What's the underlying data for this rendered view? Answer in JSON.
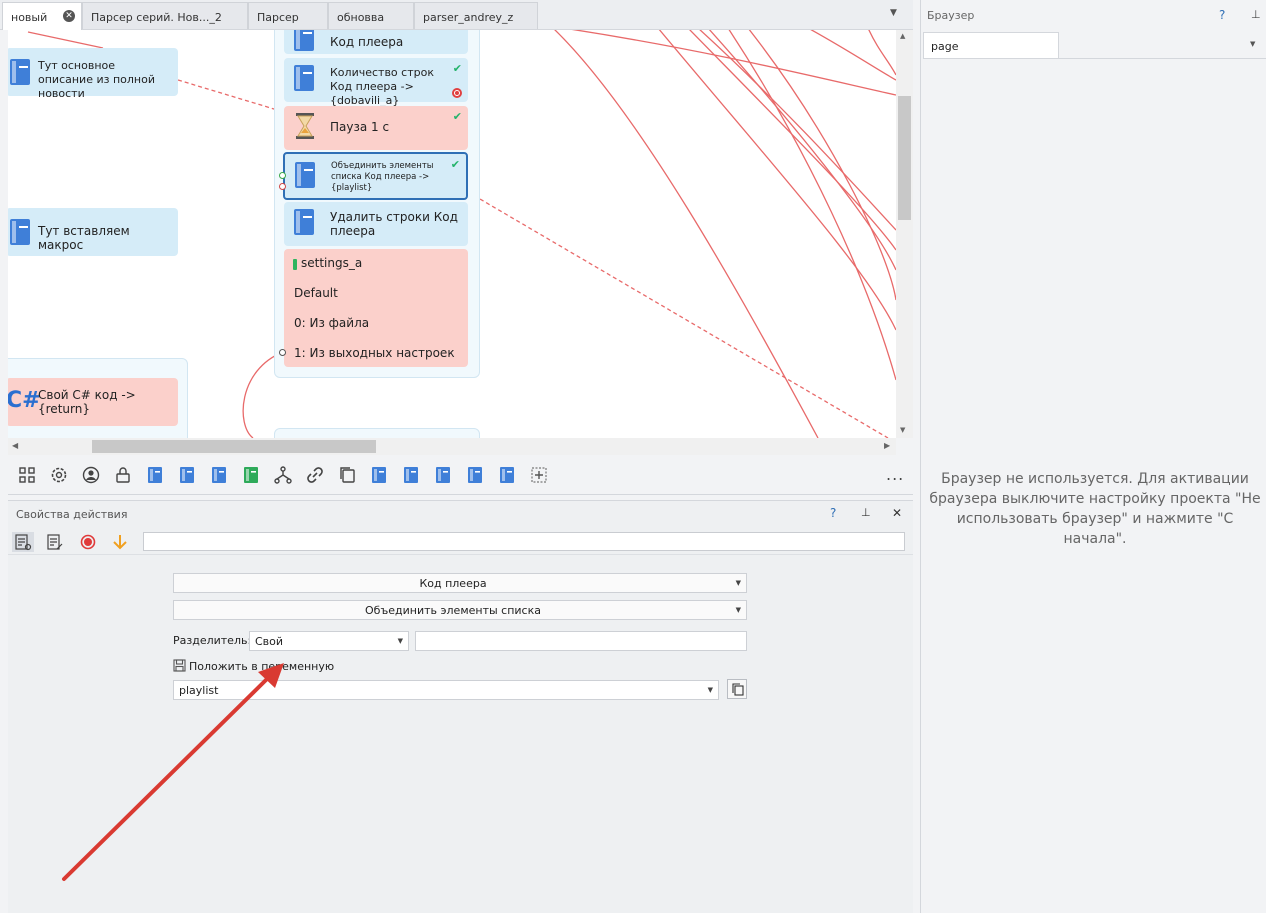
{
  "tabs": [
    {
      "label": "новый",
      "active": true
    },
    {
      "label": "Парсер серий. Нов..._2"
    },
    {
      "label": "Парсер"
    },
    {
      "label": "обновва"
    },
    {
      "label": "parser_andrey_z"
    }
  ],
  "canvas": {
    "left_nodes": {
      "desc": "Тут основное описание из полной новости",
      "macro": "Тут вставляем макрос",
      "csharp": "Свой C# код -> {return}"
    },
    "chain": {
      "top_partial": "Код плеера",
      "count_rows": "Количество строк Код плеера -> {dobavili_a}",
      "pause": "Пауза 1 с",
      "join": "Объединить элементы списка Код плеера -> {playlist}",
      "delete_rows": "Удалить строки Код плеера",
      "settings": {
        "name": "settings_a",
        "rows": [
          "Default",
          "0: Из файла",
          "1: Из выходных настроек"
        ]
      }
    }
  },
  "toolbar": {
    "icons": [
      "grid-icon",
      "gear-icon",
      "user-icon",
      "lock-icon",
      "note-icon",
      "note-icon",
      "note-icon",
      "green-note-icon",
      "branch-icon",
      "link-icon",
      "copy-icon",
      "note-icon",
      "note-icon",
      "note-icon",
      "note-icon",
      "note-icon",
      "add-icon"
    ],
    "more": "..."
  },
  "properties": {
    "title": "Свойства действия",
    "help": "?",
    "source_list": "Код плеера",
    "operation": "Объединить элементы списка",
    "separator_label": "Разделитель:",
    "separator_value": "Свой",
    "separator_custom": "",
    "put_into_var_label": "Положить в переменную",
    "variable": "playlist",
    "comment": ""
  },
  "browser": {
    "title": "Браузер",
    "help": "?",
    "tab": "page",
    "message": "Браузер не используется. Для активации браузера выключите настройку проекта \"Не использовать браузер\" и нажмите \"С начала\"."
  },
  "colors": {
    "accent": "#2f6fb5",
    "node_blue": "#d5ecf8",
    "node_red": "#fbd0cb",
    "link": "#e86a6a",
    "arrow": "#d93a32"
  }
}
